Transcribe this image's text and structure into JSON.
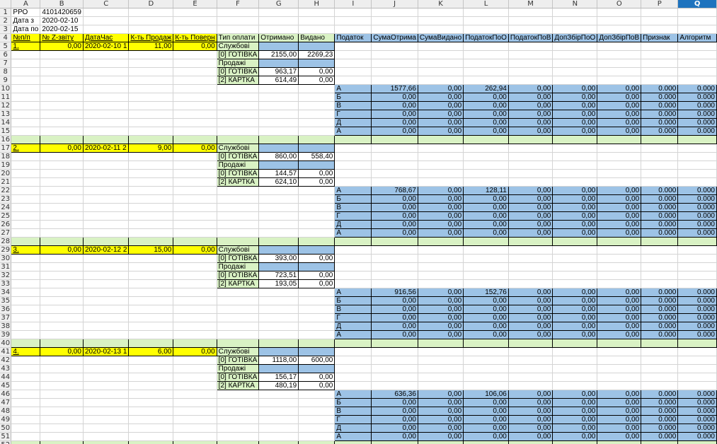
{
  "columns": [
    {
      "label": "A",
      "width": 18
    },
    {
      "label": "A",
      "width": 36
    },
    {
      "label": "B",
      "width": 59
    },
    {
      "label": "C",
      "width": 59
    },
    {
      "label": "D",
      "width": 59
    },
    {
      "label": "E",
      "width": 59
    },
    {
      "label": "F",
      "width": 59
    },
    {
      "label": "G",
      "width": 59
    },
    {
      "label": "H",
      "width": 59
    },
    {
      "label": "I",
      "width": 59
    },
    {
      "label": "J",
      "width": 59
    },
    {
      "label": "K",
      "width": 59
    },
    {
      "label": "L",
      "width": 59
    },
    {
      "label": "M",
      "width": 59
    },
    {
      "label": "N",
      "width": 59
    },
    {
      "label": "O",
      "width": 59
    },
    {
      "label": "P",
      "width": 59
    },
    {
      "label": "Q",
      "width": 59
    }
  ],
  "selected_column": "Q",
  "header_info": [
    [
      "РРО",
      "4101420659"
    ],
    [
      "Дата з",
      "2020-02-10"
    ],
    [
      "Дата по",
      "2020-02-15"
    ]
  ],
  "col_headers": [
    "№п/п",
    "№ Z-звіту",
    "ДатаЧас",
    "К-ть Продаж",
    "К-ть Поверн",
    "Тип оплати",
    "Отримано",
    "Видано",
    "Податок",
    "СумаОтрима",
    "СумаВидано",
    "ПодатокПоО",
    "ПодатокПоВ",
    "ДопЗбірПоО",
    "ДопЗбірПоВ",
    "Признак",
    "Алгоритм"
  ],
  "labels": {
    "service": "Службові",
    "sales": "Продажі",
    "cash": "[0] ГОТІВКА",
    "card": "[2] КАРТКА"
  },
  "tax_letters": [
    "А",
    "Б",
    "В",
    "Г",
    "Д",
    "А"
  ],
  "zero": "0,00",
  "zero3": "0.000",
  "blocks": [
    {
      "index": "1.",
      "z": "0,00",
      "date": "2020-02-10 1",
      "sales_count": "11,00",
      "returns": "0,00",
      "service_cash": [
        "2155,00",
        "2269,23"
      ],
      "sales_cash": [
        "963,17",
        "0,00"
      ],
      "sales_card": [
        "614,49",
        "0,00"
      ],
      "tax_first": [
        "1577,66",
        "0,00",
        "262,94"
      ]
    },
    {
      "index": "2.",
      "z": "0,00",
      "date": "2020-02-11 2",
      "sales_count": "9,00",
      "returns": "0,00",
      "service_cash": [
        "860,00",
        "558,40"
      ],
      "sales_cash": [
        "144,57",
        "0,00"
      ],
      "sales_card": [
        "624,10",
        "0,00"
      ],
      "tax_first": [
        "768,67",
        "0,00",
        "128,11"
      ]
    },
    {
      "index": "3.",
      "z": "0,00",
      "date": "2020-02-12 2",
      "sales_count": "15,00",
      "returns": "0,00",
      "service_cash": [
        "393,00",
        "0,00"
      ],
      "sales_cash": [
        "723,51",
        "0,00"
      ],
      "sales_card": [
        "193,05",
        "0,00"
      ],
      "tax_first": [
        "916,56",
        "0,00",
        "152,76"
      ]
    },
    {
      "index": "4.",
      "z": "0,00",
      "date": "2020-02-13 1",
      "sales_count": "6,00",
      "returns": "0,00",
      "service_cash": [
        "1118,00",
        "600,00"
      ],
      "sales_cash": [
        "156,17",
        "0,00"
      ],
      "sales_card": [
        "480,19",
        "0,00"
      ],
      "tax_first": [
        "636,36",
        "0,00",
        "106,06"
      ]
    }
  ]
}
